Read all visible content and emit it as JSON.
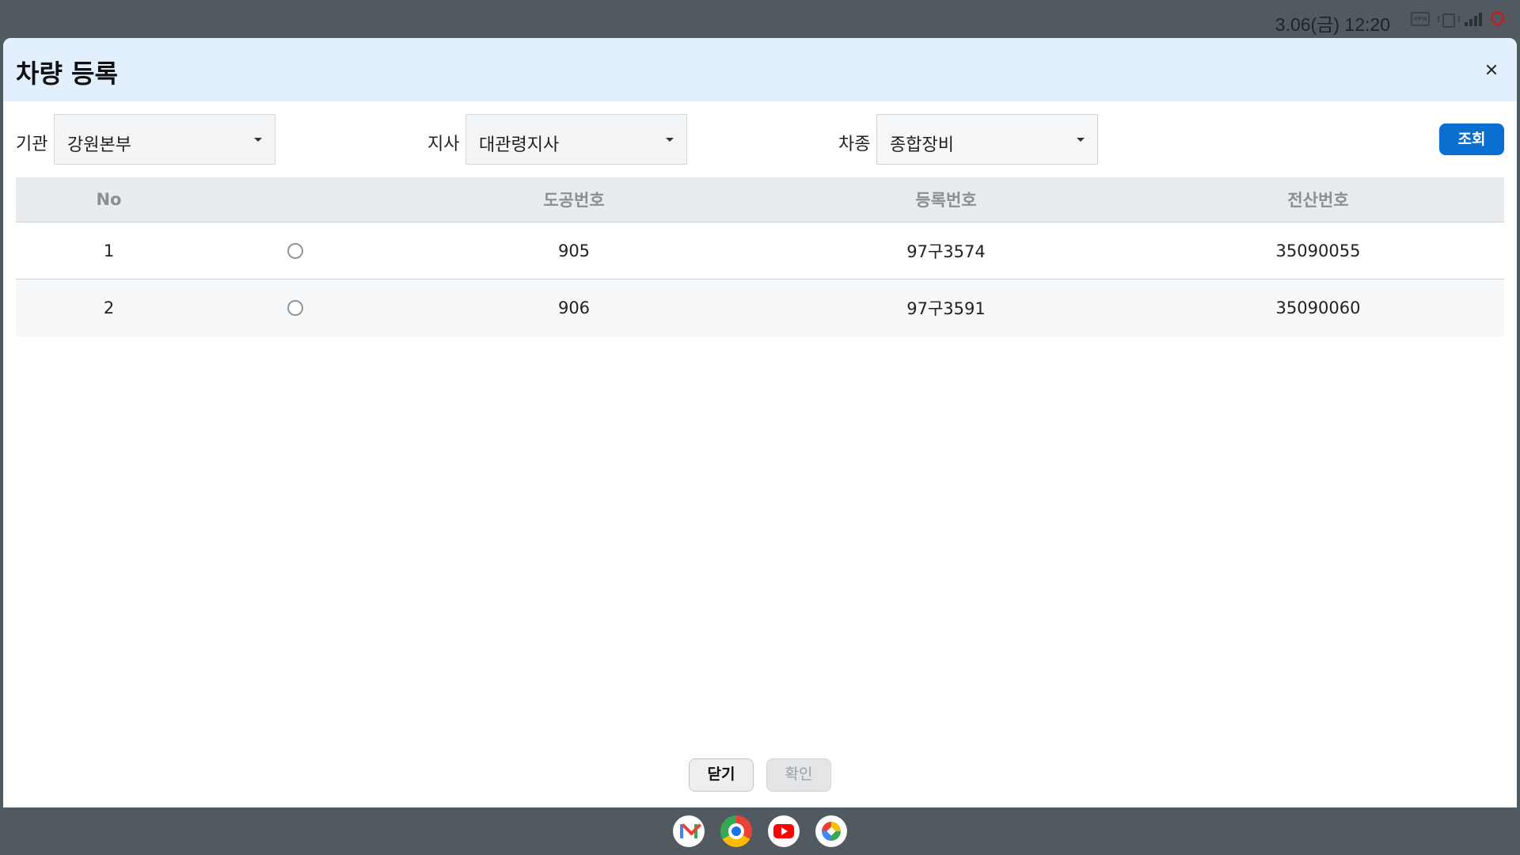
{
  "status_bar": {
    "time": "3.06(금) 12:20",
    "icons": [
      "vpn-icon",
      "vibrate-icon",
      "signal-icon",
      "location-icon"
    ]
  },
  "dialog": {
    "title": "차량 등록",
    "filters": {
      "org_label": "기관",
      "org_value": "강원본부",
      "branch_label": "지사",
      "branch_value": "대관령지사",
      "type_label": "차종",
      "type_value": "종합장비"
    },
    "search_label": "조회",
    "table": {
      "headers": [
        "No",
        "",
        "도공번호",
        "등록번호",
        "전산번호"
      ],
      "rows": [
        {
          "no": "1",
          "road_no": "905",
          "reg_no": "97구3574",
          "comp_no": "35090055"
        },
        {
          "no": "2",
          "road_no": "906",
          "reg_no": "97구3591",
          "comp_no": "35090060"
        }
      ]
    },
    "close_label": "닫기",
    "confirm_label": "확인"
  },
  "dock": {
    "apps": [
      "gmail-icon",
      "chrome-icon",
      "youtube-icon",
      "photos-icon"
    ]
  },
  "colors": {
    "accent": "#0a6fd1",
    "header_bg": "#e2f0fd",
    "system_bg": "#525a61"
  }
}
